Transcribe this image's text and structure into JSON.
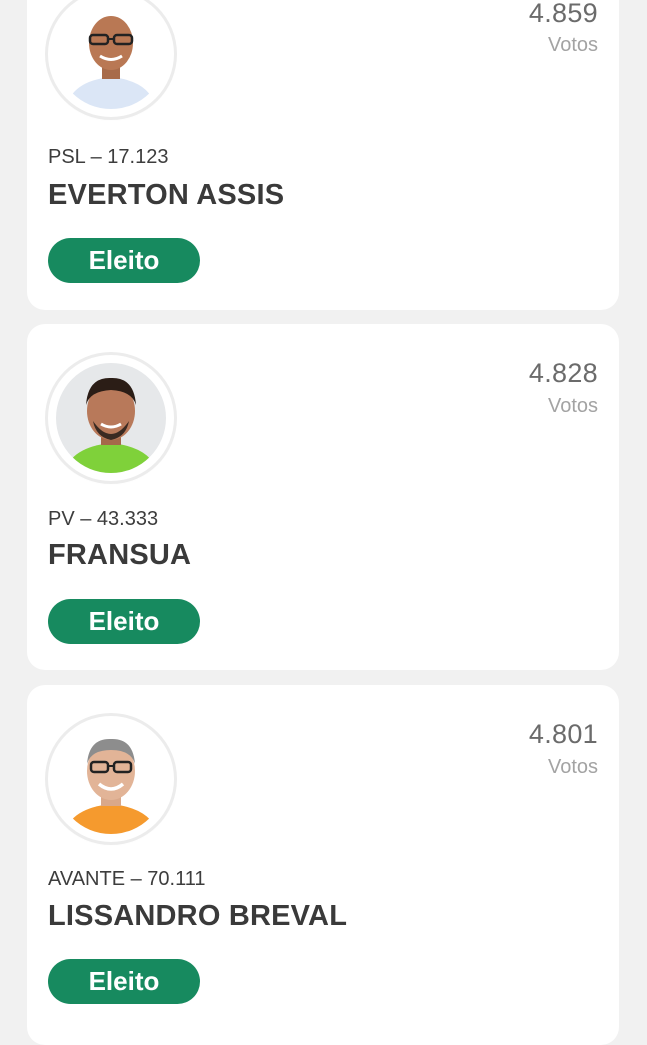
{
  "candidates": [
    {
      "votes": "4.859",
      "votes_label": "Votos",
      "party": "PSL – 17.123",
      "name": "EVERTON ASSIS",
      "status": "Eleito",
      "shirt_color": "#dbe6f6"
    },
    {
      "votes": "4.828",
      "votes_label": "Votos",
      "party": "PV – 43.333",
      "name": "FRANSUA",
      "status": "Eleito",
      "shirt_color": "#7fd13a"
    },
    {
      "votes": "4.801",
      "votes_label": "Votos",
      "party": "AVANTE – 70.111",
      "name": "LISSANDRO BREVAL",
      "status": "Eleito",
      "shirt_color": "#f59a2e"
    }
  ],
  "colors": {
    "badge": "#178a5f",
    "page_bg": "#f1f1f1"
  }
}
